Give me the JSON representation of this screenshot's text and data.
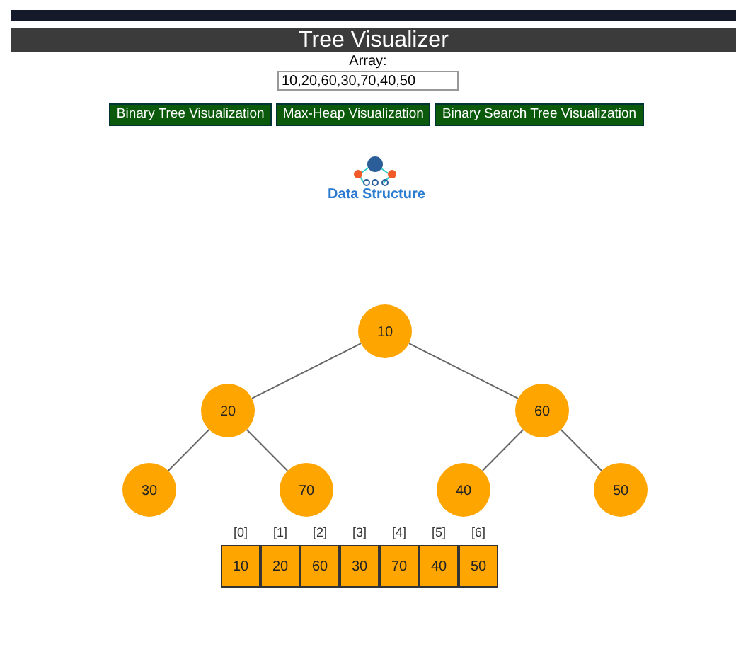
{
  "header": {
    "title": "Tree Visualizer"
  },
  "array_input": {
    "label": "Array:",
    "value": "10,20,60,30,70,40,50"
  },
  "buttons": [
    {
      "label": "Binary Tree Visualization"
    },
    {
      "label": "Max-Heap Visualization"
    },
    {
      "label": "Binary Search Tree Visualization"
    }
  ],
  "logo": {
    "caption": "Data Structure"
  },
  "tree": {
    "value": "10",
    "children": [
      {
        "value": "20",
        "children": [
          {
            "value": "30"
          },
          {
            "value": "70"
          }
        ]
      },
      {
        "value": "60",
        "children": [
          {
            "value": "40"
          },
          {
            "value": "50"
          }
        ]
      }
    ]
  },
  "array_cells": [
    {
      "index": "[0]",
      "value": "10"
    },
    {
      "index": "[1]",
      "value": "20"
    },
    {
      "index": "[2]",
      "value": "60"
    },
    {
      "index": "[3]",
      "value": "30"
    },
    {
      "index": "[4]",
      "value": "70"
    },
    {
      "index": "[5]",
      "value": "40"
    },
    {
      "index": "[6]",
      "value": "50"
    }
  ]
}
